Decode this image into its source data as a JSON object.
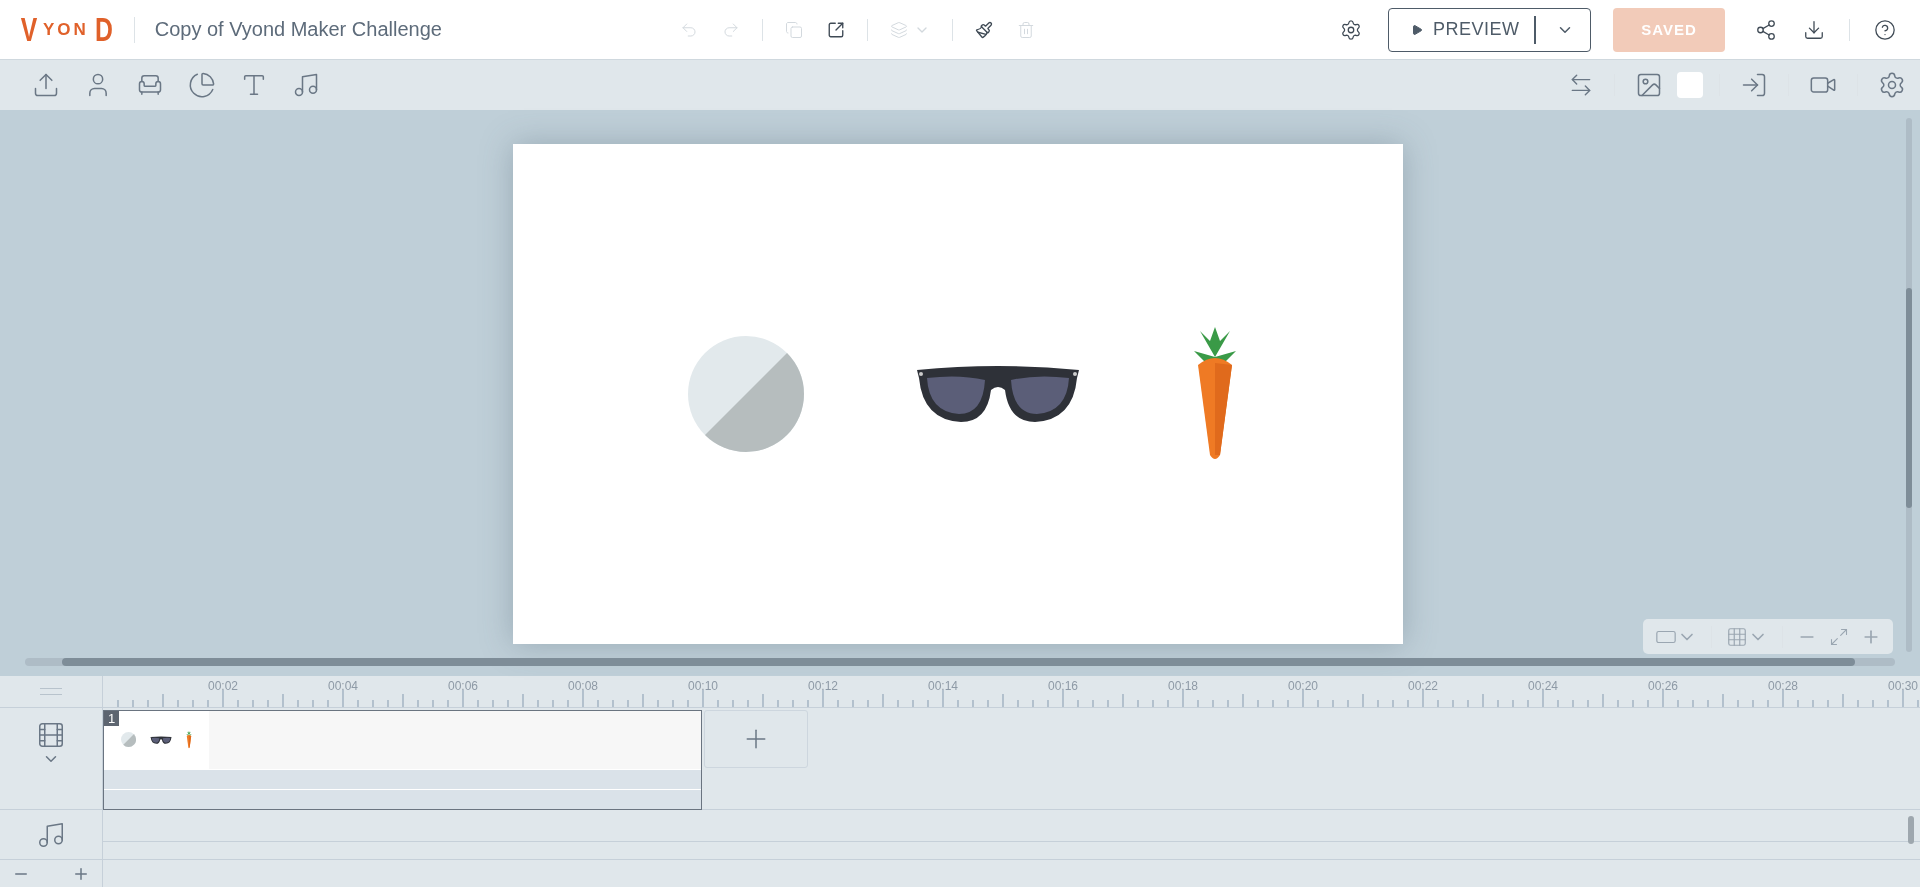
{
  "app": {
    "logo": "VYOND",
    "title": "Copy of Vyond Maker Challenge"
  },
  "header": {
    "edit_actions": [
      {
        "disabled": true
      },
      {
        "disabled": true
      },
      {
        "disabled": true
      },
      {
        "disabled": false
      },
      {
        "disabled": true
      },
      {
        "disabled": false
      },
      {
        "disabled": true
      }
    ],
    "preview": "PREVIEW",
    "save": {
      "label": "SAVED",
      "disabled": true
    }
  },
  "timeline": {
    "ruler": [
      "00:02",
      "00:04",
      "00:06",
      "00:08",
      "00:10",
      "00:12",
      "00:14",
      "00:16",
      "00:18",
      "00:20",
      "00:22",
      "00:24",
      "00:26",
      "00:28",
      "00:30"
    ],
    "scenes": [
      {
        "number": "1",
        "selected": true
      }
    ]
  }
}
